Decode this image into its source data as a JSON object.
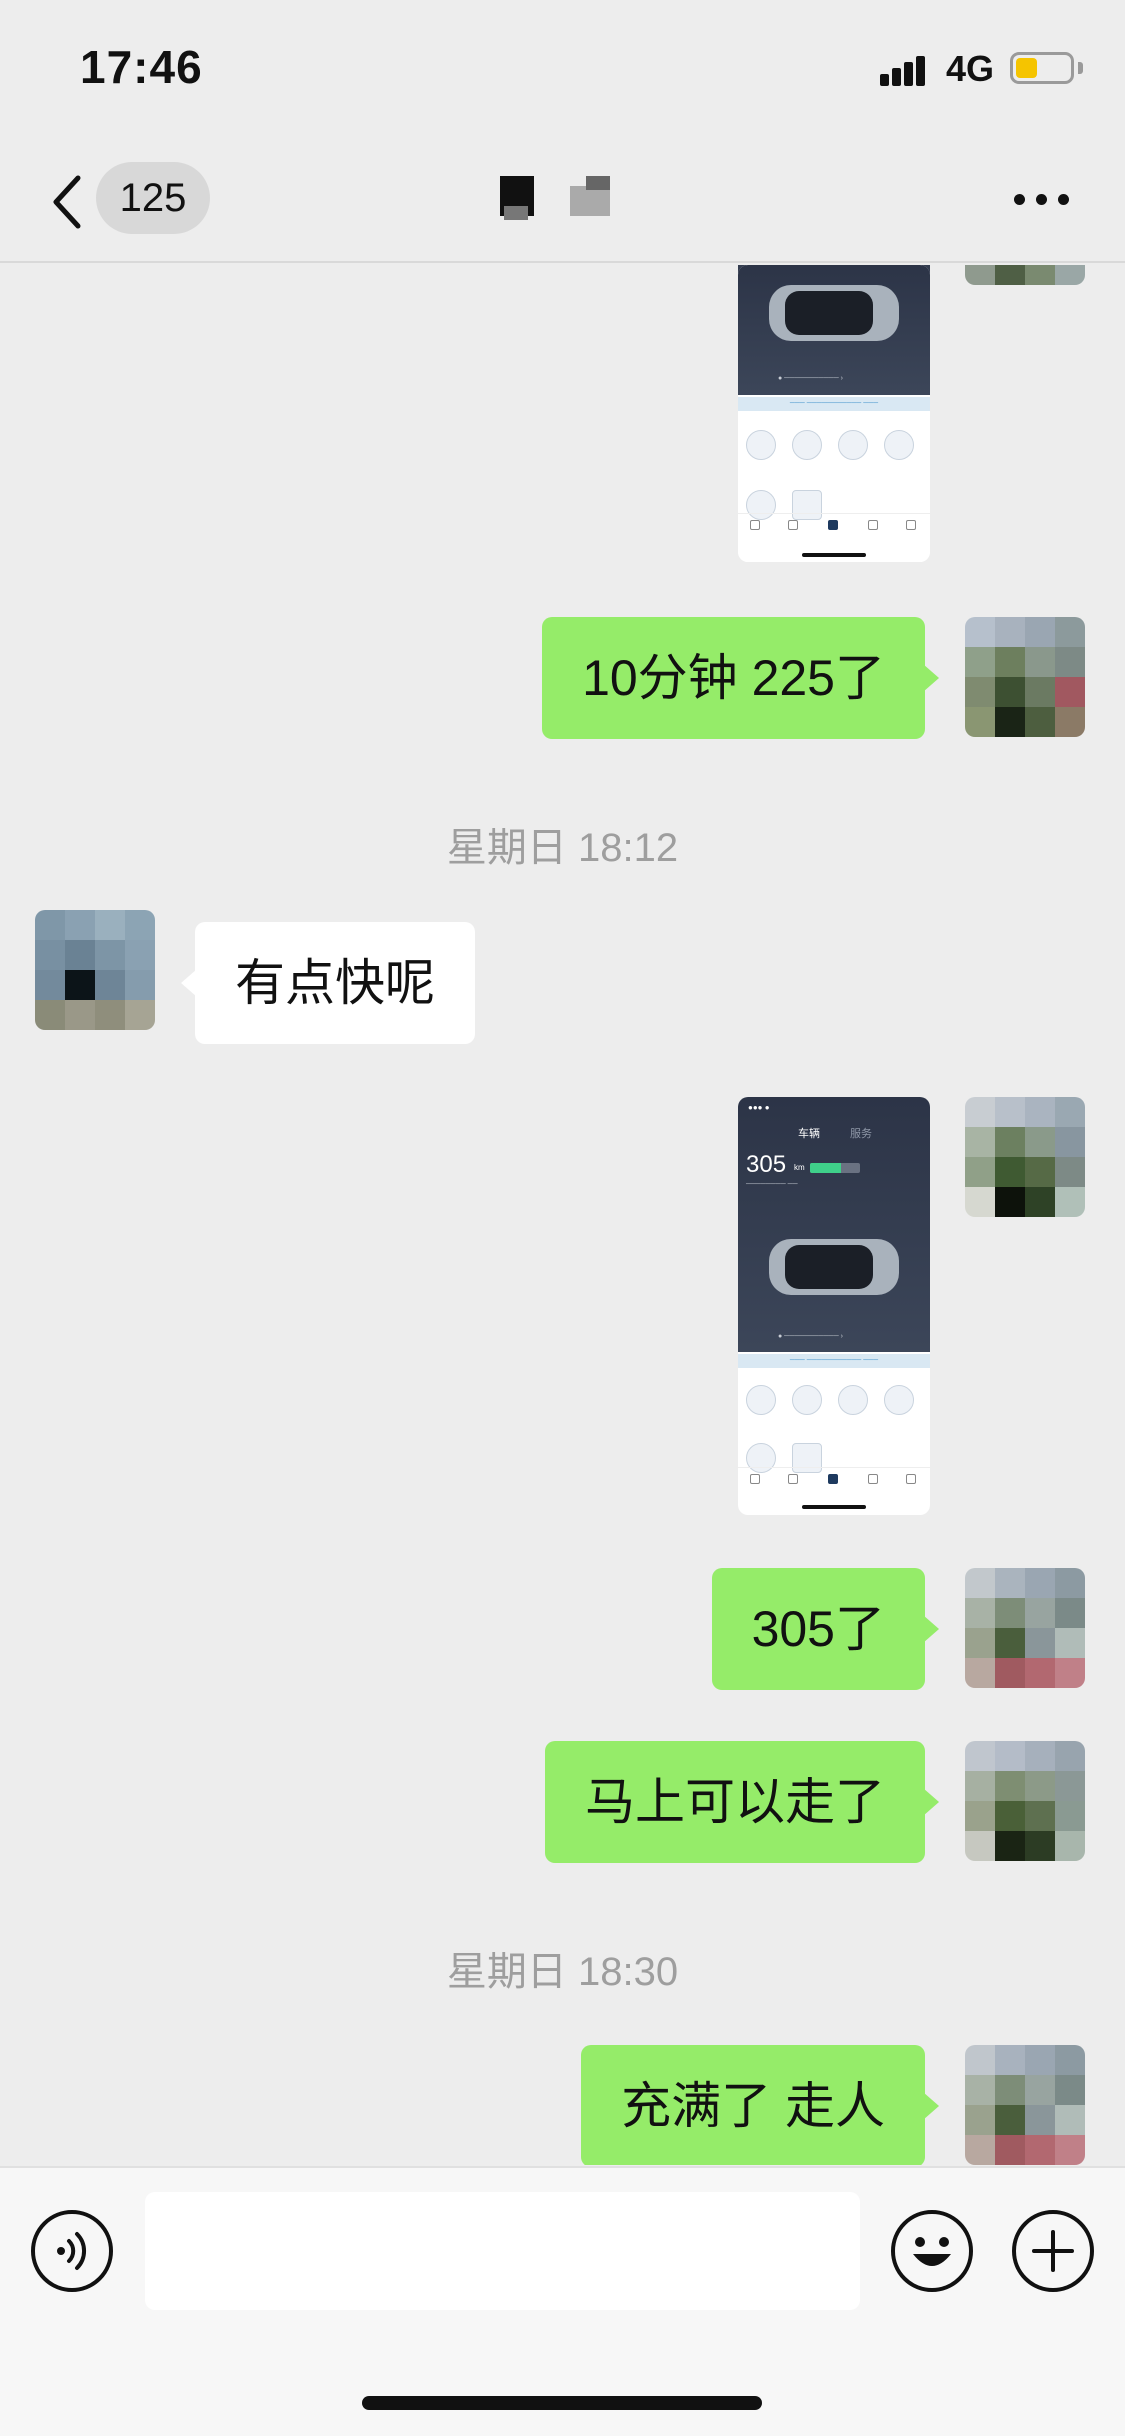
{
  "status_bar": {
    "time": "17:46",
    "network": "4G",
    "battery_level": 0.4
  },
  "nav": {
    "unread_count": "125",
    "back_icon": "chevron-left-icon",
    "more_icon": "more-horizontal-icon"
  },
  "thumbnail": {
    "range_value": "305",
    "range_unit": "km",
    "tab_vehicle": "车辆",
    "tab_service": "服务"
  },
  "messages": {
    "m1": "10分钟 225了",
    "ts1": "星期日 18:12",
    "m2": "有点快呢",
    "m3": "305了",
    "m4": "马上可以走了",
    "ts2": "星期日 18:30",
    "m5": "充满了 走人"
  },
  "input_bar": {
    "voice_icon": "voice-icon",
    "emoji_icon": "emoji-icon",
    "plus_icon": "plus-icon",
    "placeholder": ""
  },
  "colors": {
    "outgoing_bubble": "#95ec69",
    "incoming_bubble": "#ffffff",
    "background": "#ededed",
    "battery": "#f5c400"
  }
}
